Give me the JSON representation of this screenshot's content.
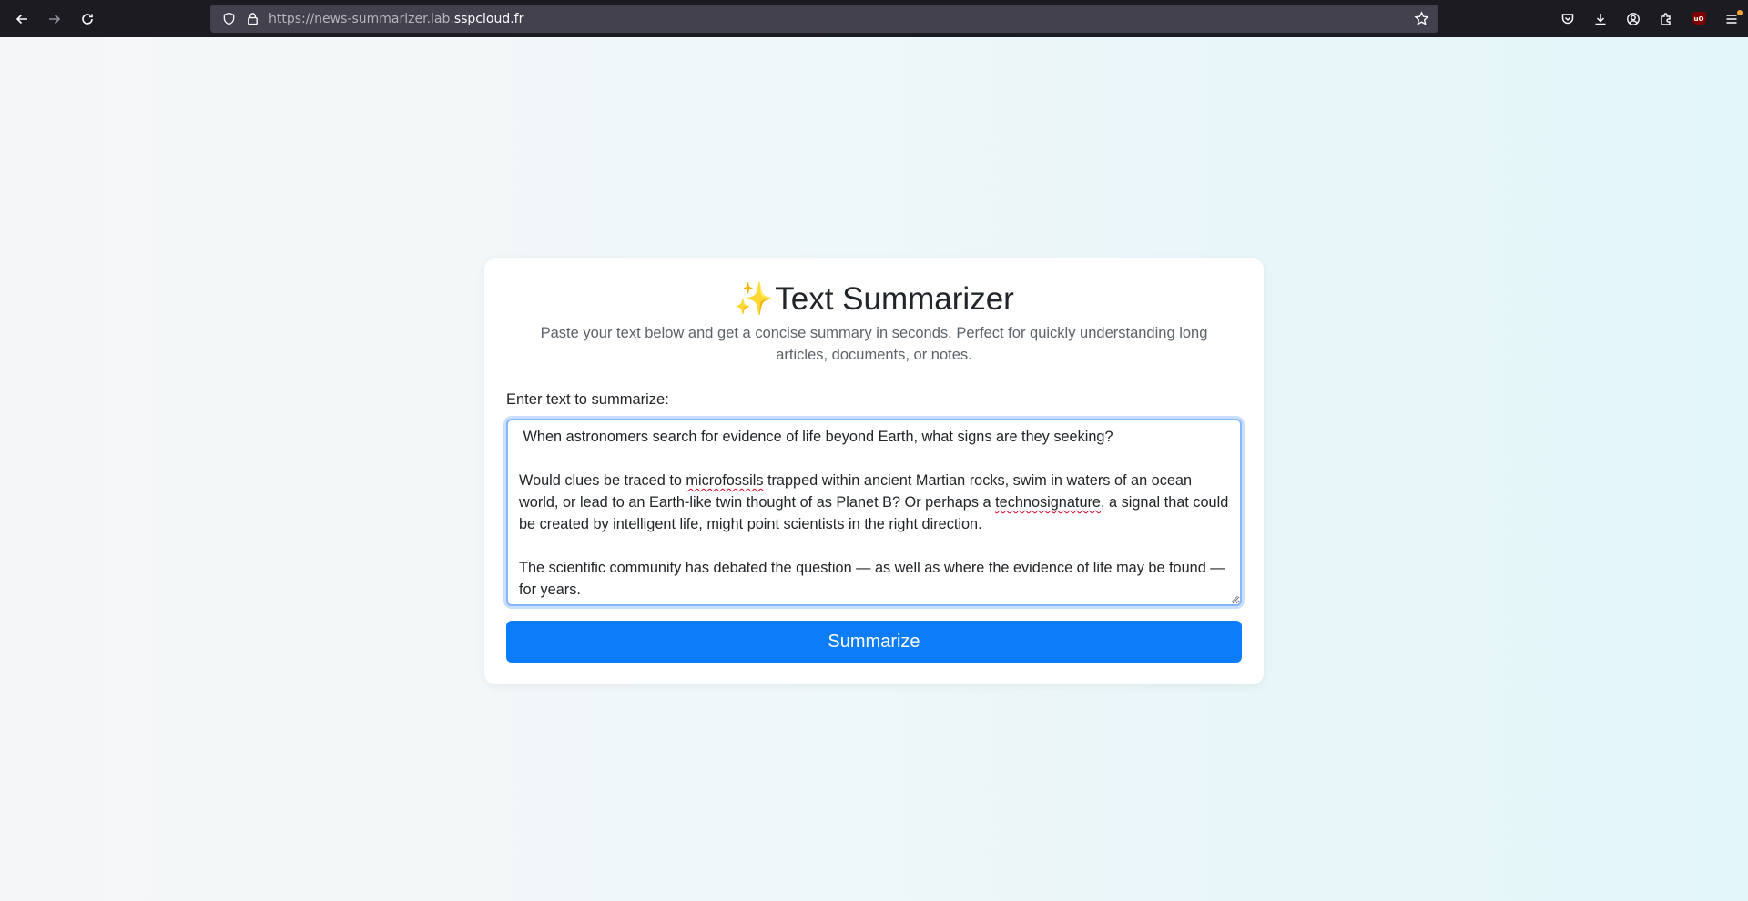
{
  "browser": {
    "url_scheme_path": "https://news-summarizer.lab.",
    "url_host": "sspcloud.fr",
    "icons": {
      "back": "back-arrow-icon",
      "forward": "forward-arrow-icon",
      "reload": "reload-icon",
      "shield": "tracking-protection-shield-icon",
      "lock": "padlock-icon",
      "bookmark": "bookmark-star-icon",
      "pocket": "pocket-icon",
      "downloads": "download-icon",
      "account": "account-icon",
      "extensions": "extensions-puzzle-icon",
      "ublock": "ublock-origin-icon",
      "menu": "hamburger-menu-icon"
    },
    "ublock_text": "uO"
  },
  "app": {
    "title_emoji": "✨",
    "title": "Text Summarizer",
    "subtitle": "Paste your text below and get a concise summary in seconds. Perfect for quickly understanding long articles, documents, or notes.",
    "input_label": "Enter text to summarize:",
    "textarea": {
      "para1": " When astronomers search for evidence of life beyond Earth, what signs are they seeking?",
      "para2_a": "Would clues be traced to ",
      "para2_word1": "microfossils",
      "para2_b": " trapped within ancient Martian rocks, swim in waters of an ocean world, or lead to an Earth-like twin thought of as Planet B? Or perhaps a ",
      "para2_word2": "technosignature",
      "para2_c": ", a signal that could be created by intelligent life, might point scientists in the right direction.",
      "para3": "The scientific community has debated the question — as well as where the evidence of life may be found — for years."
    },
    "submit_label": "Summarize"
  },
  "colors": {
    "browser_bg": "#1c1b22",
    "urlbar_bg": "#42414d",
    "button_bg": "#0d7cf8",
    "focus_border": "#86b7fe"
  }
}
